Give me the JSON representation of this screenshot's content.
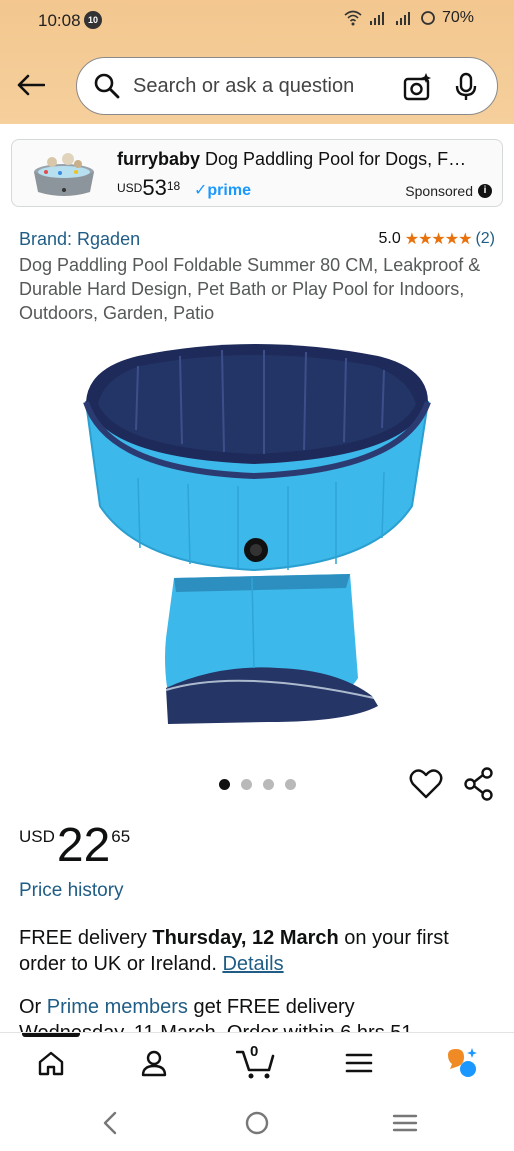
{
  "status_bar": {
    "time": "10:08",
    "notification_badge": "10",
    "battery": "70%"
  },
  "search": {
    "placeholder": "Search or ask a question"
  },
  "sponsored_ad": {
    "brand": "furrybaby",
    "title": " Dog Paddling Pool for Dogs, F…",
    "price_currency": "USD",
    "price_whole": "53",
    "price_fraction": "18",
    "prime_label": "✓prime",
    "sponsored_label": "Sponsored"
  },
  "product": {
    "brand_link": "Brand: Rgaden",
    "rating_value": "5.0",
    "rating_count": "(2)",
    "title": "Dog Paddling Pool Foldable Summer 80 CM, Leakproof & Durable Hard Design, Pet Bath or Play Pool for Indoors, Outdoors, Garden, Patio",
    "image_count": 4,
    "active_image_index": 0,
    "price_currency": "USD",
    "price_whole": "22",
    "price_fraction": "65",
    "price_history_link": "Price history",
    "delivery_prefix": "FREE delivery ",
    "delivery_date": "Thursday, 12 March",
    "delivery_suffix": " on your first order to UK or Ireland. ",
    "details_link": "Details",
    "prime_prefix": "Or ",
    "prime_members_link": "Prime members",
    "prime_suffix": " get FREE delivery",
    "cut_off_text": "Wednesday, 11 March. Order within 6 hrs 51"
  },
  "bottom_nav": {
    "cart_count": "0"
  },
  "colors": {
    "header_bg": "#f3c78f",
    "link_blue": "#1f5d86",
    "star_orange": "#e8710b",
    "prime_blue": "#1a98ff",
    "pool_blue": "#3cb8ea",
    "pool_navy": "#1d2a5a"
  }
}
